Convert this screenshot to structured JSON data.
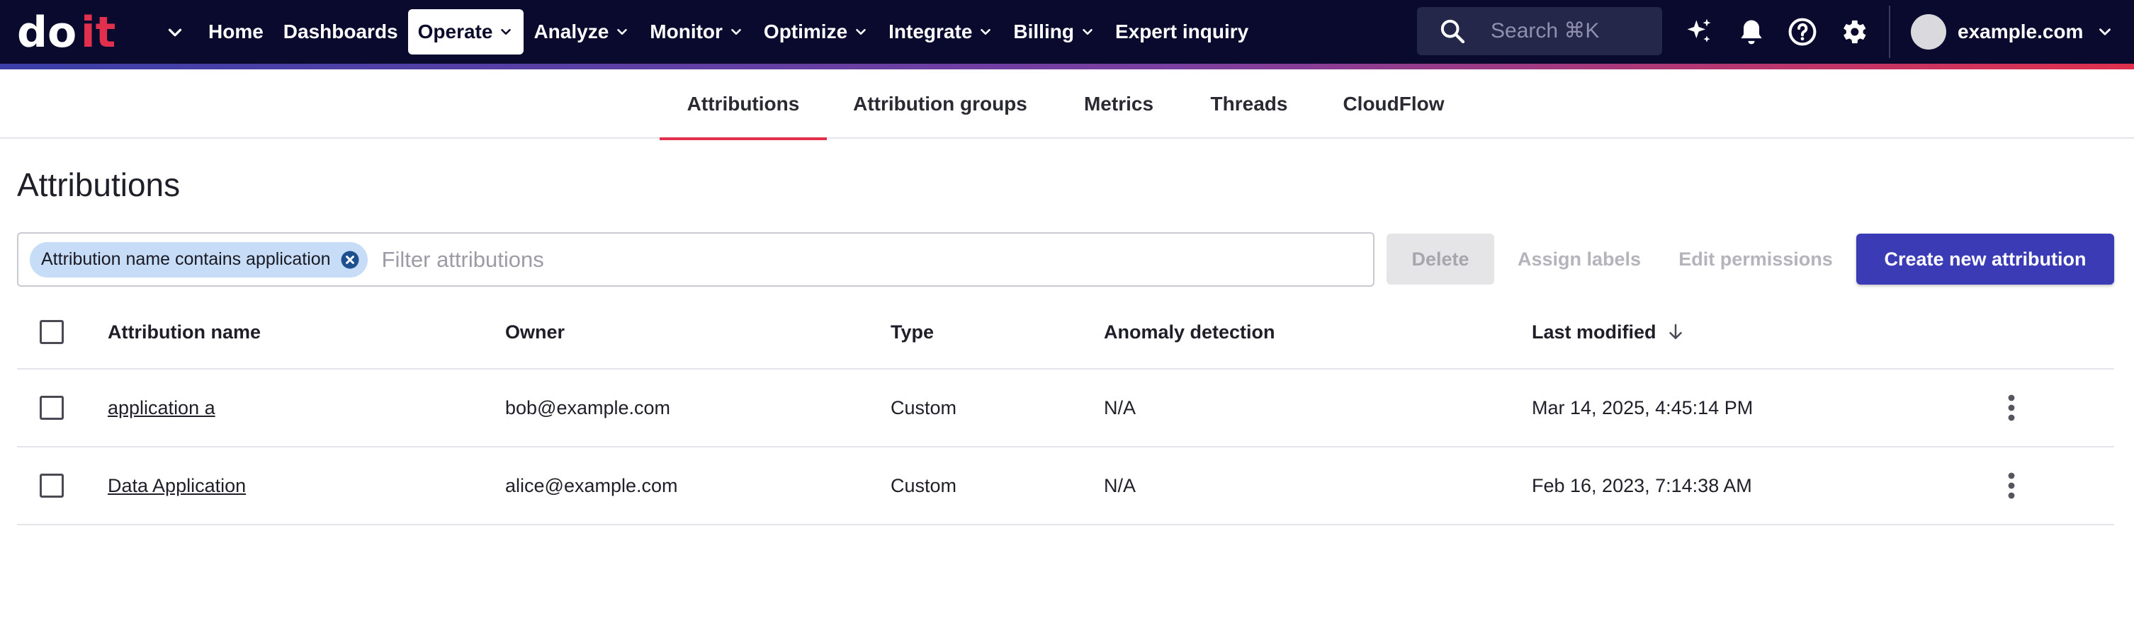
{
  "brand": {
    "logo_text": "doit"
  },
  "nav": {
    "items": [
      {
        "label": "Home",
        "has_menu": false
      },
      {
        "label": "Dashboards",
        "has_menu": false
      },
      {
        "label": "Operate",
        "has_menu": true,
        "active": true
      },
      {
        "label": "Analyze",
        "has_menu": true
      },
      {
        "label": "Monitor",
        "has_menu": true
      },
      {
        "label": "Optimize",
        "has_menu": true
      },
      {
        "label": "Integrate",
        "has_menu": true
      },
      {
        "label": "Billing",
        "has_menu": true
      },
      {
        "label": "Expert inquiry",
        "has_menu": false
      }
    ]
  },
  "search": {
    "placeholder": "Search ⌘K"
  },
  "account": {
    "name": "example.com"
  },
  "icons": [
    "menu-chevron-icon",
    "search-icon",
    "sparkle-icon",
    "bell-icon",
    "help-icon",
    "gear-icon",
    "avatar"
  ],
  "colors": {
    "nav_bg": "#090a2e",
    "accent": "#e0304d",
    "primary_button": "#3b3cb5",
    "chip_bg": "#c7dcf7"
  },
  "tabs": [
    {
      "label": "Attributions",
      "active": true
    },
    {
      "label": "Attribution groups"
    },
    {
      "label": "Metrics"
    },
    {
      "label": "Threads"
    },
    {
      "label": "CloudFlow"
    }
  ],
  "page": {
    "title": "Attributions"
  },
  "filter": {
    "chip_label": "Attribution name contains application",
    "placeholder": "Filter attributions"
  },
  "actions": {
    "delete": "Delete",
    "assign_labels": "Assign labels",
    "edit_permissions": "Edit permissions",
    "create": "Create new attribution"
  },
  "table": {
    "columns": {
      "name": "Attribution name",
      "owner": "Owner",
      "type": "Type",
      "anomaly": "Anomaly detection",
      "modified": "Last modified"
    },
    "sort": {
      "column": "modified",
      "direction": "descending"
    },
    "rows": [
      {
        "name": "application a",
        "owner": "bob@example.com",
        "type": "Custom",
        "anomaly": "N/A",
        "modified": "Mar 14, 2025, 4:45:14 PM"
      },
      {
        "name": "Data Application",
        "owner": "alice@example.com",
        "type": "Custom",
        "anomaly": "N/A",
        "modified": "Feb 16, 2023, 7:14:38 AM"
      }
    ]
  }
}
